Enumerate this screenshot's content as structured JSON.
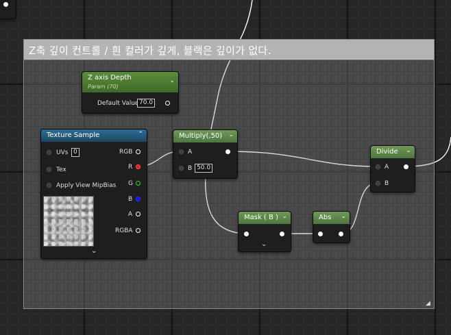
{
  "comment": {
    "title": "Z축 깊이 컨트롤 / 흰 컬러가 깊게, 블랙은 깊이가 없다."
  },
  "param_node": {
    "title": "Z axis Depth",
    "subtitle": "Param (70)",
    "default_label": "Default Value",
    "default_value": "70.0"
  },
  "texture_node": {
    "title": "Texture Sample",
    "uvs_label": "UVs",
    "uvs_value": "0",
    "tex_label": "Tex",
    "apply_label": "Apply View MipBias",
    "outputs": [
      "RGB",
      "R",
      "G",
      "B",
      "A",
      "RGBA"
    ]
  },
  "multiply_node": {
    "title": "Multiply(,50)",
    "a_label": "A",
    "b_label": "B",
    "b_value": "50.0"
  },
  "mask_node": {
    "title": "Mask ( B )"
  },
  "abs_node": {
    "title": "Abs"
  },
  "divide_node": {
    "title": "Divide",
    "a_label": "A",
    "b_label": "B"
  },
  "colors": {
    "wire": "#ffffff",
    "r_pin": "#ff1010",
    "g_pin": "#20e020",
    "b_pin": "#1010ff"
  }
}
